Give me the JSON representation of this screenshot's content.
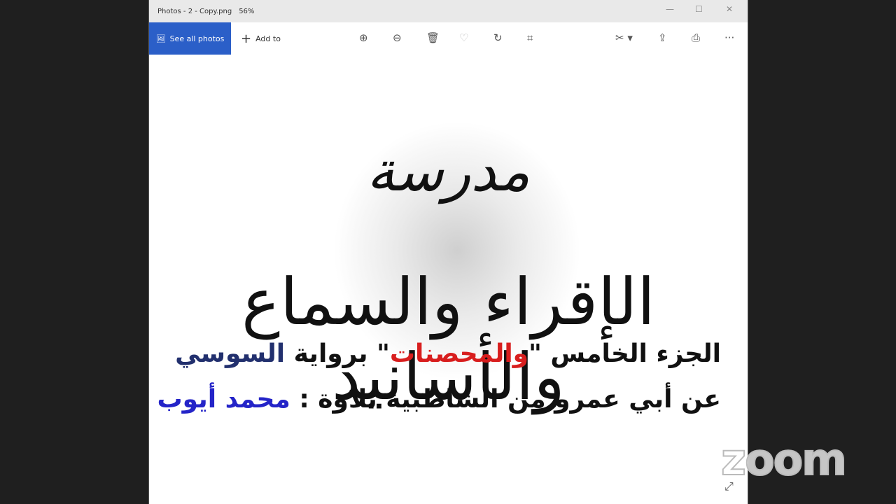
{
  "window": {
    "title": "Photos - 2 - Copy.png",
    "zoom": "56%",
    "minimize": "—",
    "maximize": "☐",
    "close": "✕"
  },
  "toolbar": {
    "see_all": "See all photos",
    "add_to": "Add to"
  },
  "image": {
    "heading": "مدرسة",
    "title": "الإقراء والسماع والأسانيد",
    "line1": {
      "a": "الجزء الخامس ",
      "quote_open": "\"",
      "highlight": "والمحصنات",
      "quote_close": "\"",
      "b": " برواية ",
      "c": "السوسي"
    },
    "line2": {
      "a": "عن أبي عمرو من الشاطبية تلاوة : ",
      "reciter": "محمد أيوب"
    }
  },
  "watermark": "zoom"
}
